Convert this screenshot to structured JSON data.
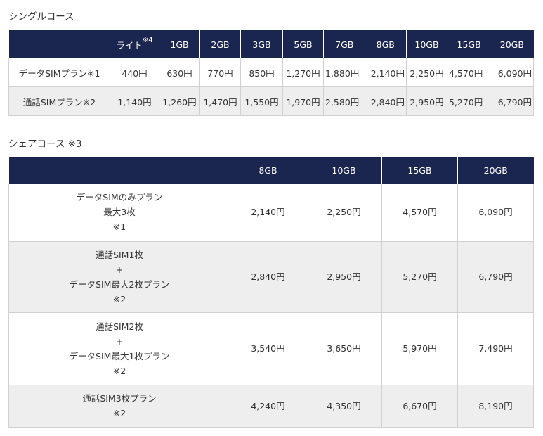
{
  "single": {
    "title": "シングルコース",
    "header": {
      "lite": "ライト",
      "lite_note": "※4",
      "plans": [
        "1GB",
        "2GB",
        "3GB",
        "5GB",
        "7GB",
        "8GB",
        "10GB",
        "15GB",
        "20GB"
      ]
    },
    "rows": [
      {
        "label": "データSIMプラン※1",
        "lite": "440円",
        "prices": [
          "630円",
          "770円",
          "850円",
          "1,270円",
          "1,880円",
          "2,140円",
          "2,250円",
          "4,570円",
          "6,090円"
        ]
      },
      {
        "label": "通話SIMプラン※2",
        "lite": "1,140円",
        "prices": [
          "1,260円",
          "1,470円",
          "1,550円",
          "1,970円",
          "2,580円",
          "2,840円",
          "2,950円",
          "5,270円",
          "6,790円"
        ]
      }
    ]
  },
  "share": {
    "title": "シェアコース ※3",
    "header": [
      "8GB",
      "10GB",
      "15GB",
      "20GB"
    ],
    "rows": [
      {
        "label_lines": [
          "データSIMのみプラン",
          "最大3枚",
          "※1"
        ],
        "prices": [
          "2,140円",
          "2,250円",
          "4,570円",
          "6,090円"
        ]
      },
      {
        "label_lines": [
          "通話SIM1枚",
          "+",
          "データSIM最大2枚プラン",
          "※2"
        ],
        "prices": [
          "2,840円",
          "2,950円",
          "5,270円",
          "6,790円"
        ]
      },
      {
        "label_lines": [
          "通話SIM2枚",
          "+",
          "データSIM最大1枚プラン",
          "※2"
        ],
        "prices": [
          "3,540円",
          "3,650円",
          "5,970円",
          "7,490円"
        ]
      },
      {
        "label_lines": [
          "通話SIM3枚プラン",
          "※2"
        ],
        "prices": [
          "4,240円",
          "4,350円",
          "6,670円",
          "8,190円"
        ]
      }
    ]
  }
}
